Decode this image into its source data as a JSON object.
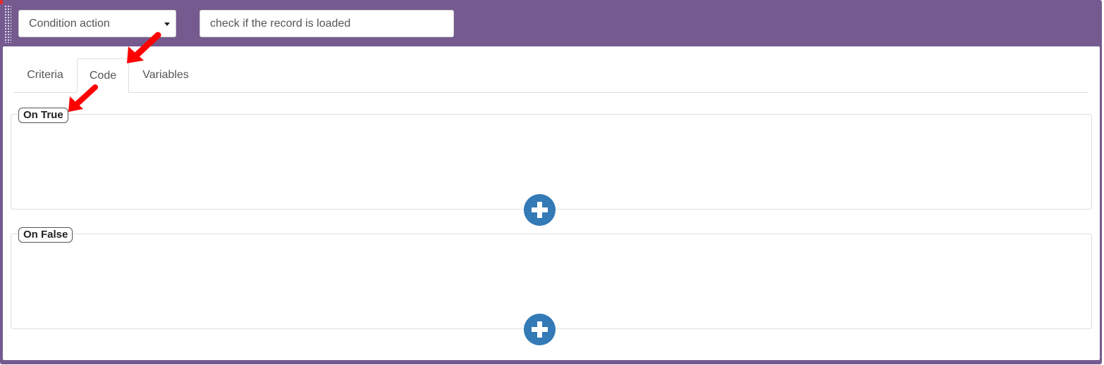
{
  "header": {
    "action_select": {
      "value": "Condition action"
    },
    "description_input": {
      "value": "check if the record is loaded"
    }
  },
  "tabs": [
    {
      "label": "Criteria",
      "active": false
    },
    {
      "label": "Code",
      "active": true
    },
    {
      "label": "Variables",
      "active": false
    }
  ],
  "sections": {
    "on_true": {
      "legend": "On True",
      "add_icon": "plus-circle-icon"
    },
    "on_false": {
      "legend": "On False",
      "add_icon": "plus-circle-icon"
    }
  },
  "annotations": {
    "arrow_color": "#ff0000"
  },
  "colors": {
    "panel": "#745a8f",
    "accent": "#337ab7",
    "corner": "#e02b2b"
  }
}
